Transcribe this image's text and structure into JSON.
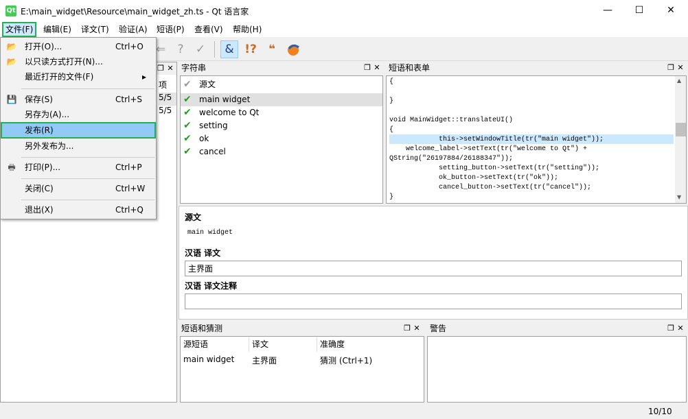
{
  "window": {
    "title": "E:\\main_widget\\Resource\\main_widget_zh.ts - Qt 语言家",
    "app_icon_label": "Qt",
    "minimize": "—",
    "maximize": "☐",
    "close": "✕"
  },
  "menubar": [
    "文件(F)",
    "编辑(E)",
    "译文(T)",
    "验证(A)",
    "短语(P)",
    "查看(V)",
    "帮助(H)"
  ],
  "file_menu": {
    "items": [
      {
        "label": "打开(O)...",
        "shortcut": "Ctrl+O",
        "icon": "folder-open-icon"
      },
      {
        "label": "以只读方式打开(N)...",
        "shortcut": "",
        "icon": "folder-open-icon"
      },
      {
        "label": "最近打开的文件(F)",
        "shortcut": "▸",
        "icon": ""
      },
      {
        "label": "保存(S)",
        "shortcut": "Ctrl+S",
        "icon": "save-icon"
      },
      {
        "label": "另存为(A)...",
        "shortcut": "",
        "icon": ""
      },
      {
        "label": "发布(R)",
        "shortcut": "",
        "icon": ""
      },
      {
        "label": "另外发布为...",
        "shortcut": "",
        "icon": ""
      },
      {
        "label": "打印(P)...",
        "shortcut": "Ctrl+P",
        "icon": "printer-icon"
      },
      {
        "label": "关闭(C)",
        "shortcut": "Ctrl+W",
        "icon": ""
      },
      {
        "label": "退出(X)",
        "shortcut": "Ctrl+Q",
        "icon": ""
      }
    ]
  },
  "context_dock": {
    "partial_labels": [
      "项",
      "5/5",
      "5/5"
    ]
  },
  "strings_dock": {
    "title": "字符串",
    "header": "源文",
    "rows": [
      "main widget",
      "welcome to Qt",
      "setting",
      "ok",
      "cancel"
    ]
  },
  "sources_dock": {
    "title": "短语和表单",
    "code_lines": [
      "{",
      "",
      "}",
      "",
      "void MainWidget::translateUI()",
      "{",
      "            this->setWindowTitle(tr(\"main widget\"));",
      "    welcome_label->setText(tr(\"welcome to Qt\") +",
      "QString(\"26197884/26188347\"));",
      "            setting_button->setText(tr(\"setting\"));",
      "            ok_button->setText(tr(\"ok\"));",
      "            cancel_button->setText(tr(\"cancel\"));",
      "}"
    ]
  },
  "editor": {
    "source_label": "源文",
    "source_text": "main widget",
    "translation_label": "汉语  译文",
    "translation_value": "主界面",
    "comment_label": "汉语  译文注释",
    "comment_value": ""
  },
  "phrases_dock": {
    "title": "短语和猜测",
    "columns": [
      "源短语",
      "译文",
      "准确度"
    ],
    "rows": [
      [
        "main widget",
        "主界面",
        "猜测 (Ctrl+1)"
      ]
    ]
  },
  "warnings_dock": {
    "title": "警告"
  },
  "statusbar": {
    "count": "10/10"
  },
  "colors": {
    "highlight_green": "#22b14c",
    "check_green": "#1e9e1e",
    "selection": "#cce8ff",
    "code_highlight": "#cce8ff"
  }
}
